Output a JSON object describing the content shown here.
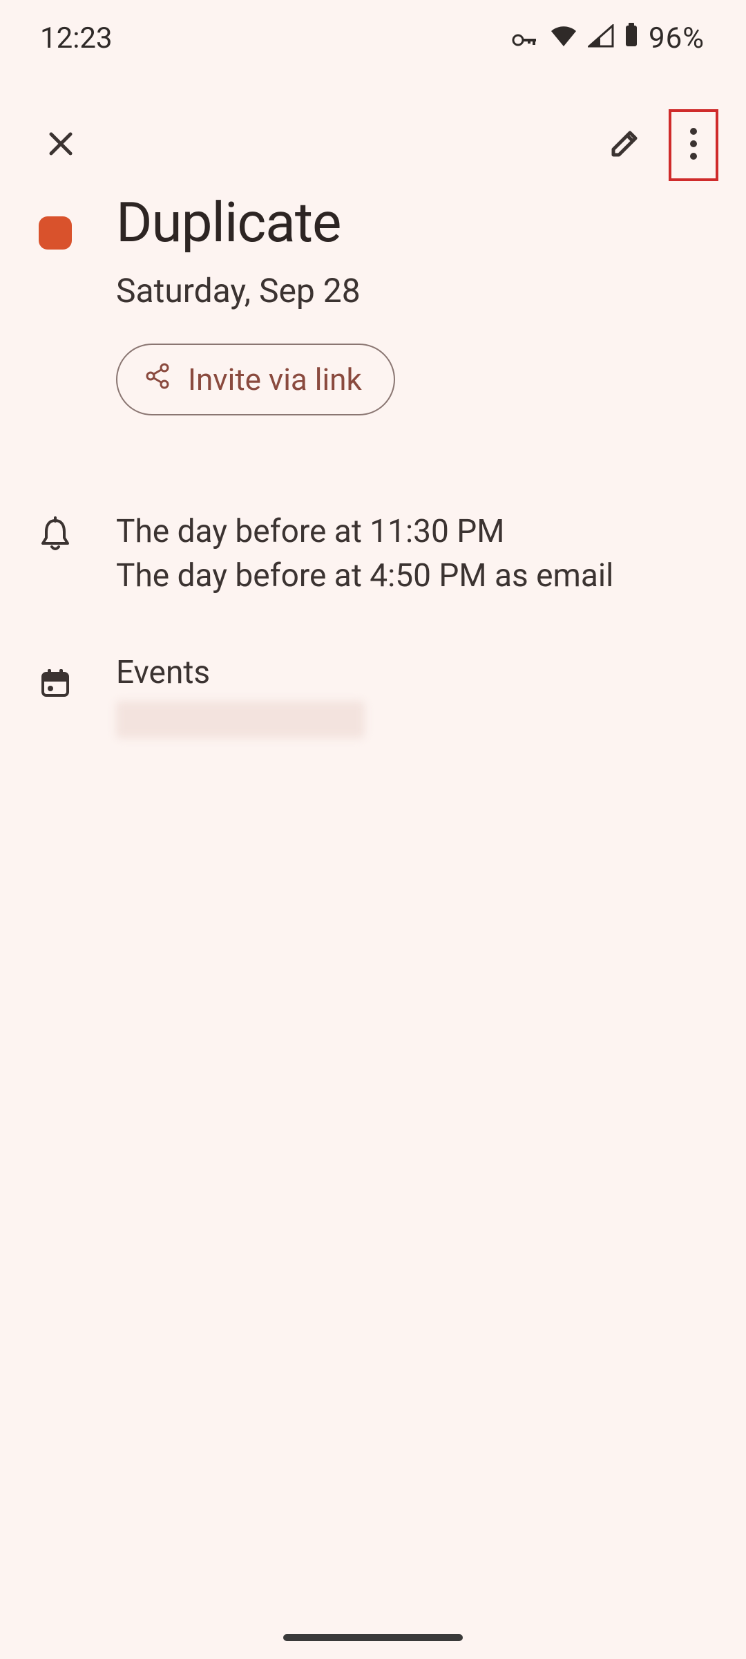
{
  "status": {
    "time": "12:23",
    "battery_pct": "96%"
  },
  "event": {
    "title": "Duplicate",
    "date": "Saturday, Sep 28",
    "color": "#d9522c",
    "invite_label": "Invite via link",
    "notifications": [
      "The day before at 11:30 PM",
      "The day before at 4:50 PM as email"
    ],
    "calendar_name": "Events"
  },
  "icons": {
    "close": "close-icon",
    "edit": "pencil-icon",
    "more": "more-vert-icon",
    "share": "share-icon",
    "bell": "bell-icon",
    "calendar": "calendar-icon",
    "vpn": "vpn-key-icon",
    "wifi": "wifi-icon",
    "signal": "cell-signal-icon",
    "battery": "battery-icon"
  }
}
